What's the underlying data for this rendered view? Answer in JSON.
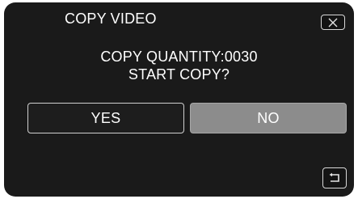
{
  "dialog": {
    "title": "COPY VIDEO",
    "message_line1": "COPY QUANTITY:0030",
    "message_line2": "START COPY?"
  },
  "buttons": {
    "yes_label": "YES",
    "no_label": "NO"
  },
  "icons": {
    "close": "close-icon",
    "back": "return-arrow-icon"
  },
  "colors": {
    "screen_background": "#1a1a1a",
    "selected_button": "#8c8c8c",
    "text": "#ffffff"
  }
}
